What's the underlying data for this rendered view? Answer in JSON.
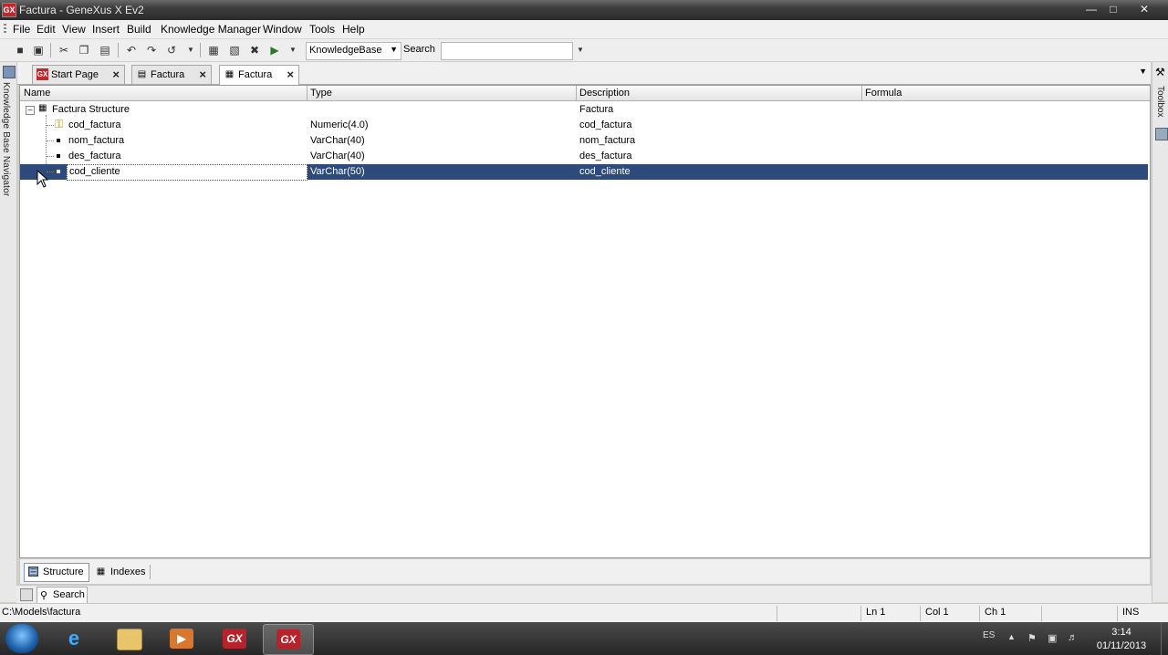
{
  "window": {
    "title": "Factura - GeneXus X Ev2",
    "app_icon": "GX"
  },
  "menu": [
    "File",
    "Edit",
    "View",
    "Insert",
    "Build",
    "Knowledge Manager",
    "Window",
    "Tools",
    "Help"
  ],
  "toolbar": {
    "kb_combo_value": "KnowledgeBase",
    "search_label": "Search",
    "search_value": ""
  },
  "side_panels": {
    "left_label": "Knowledge Base Navigator",
    "right_label": "Toolbox"
  },
  "doc_tabs": [
    {
      "label": "Start Page",
      "icon": "gx-start-icon"
    },
    {
      "label": "Factura",
      "icon": "transaction-icon"
    },
    {
      "label": "Factura",
      "icon": "table-icon",
      "active": true
    }
  ],
  "grid": {
    "columns": [
      "Name",
      "Type",
      "Description",
      "Formula"
    ],
    "root": {
      "name": "Factura Structure",
      "type": "",
      "description": "Factura",
      "formula": ""
    },
    "rows": [
      {
        "name": "cod_factura",
        "type": "Numeric(4.0)",
        "description": "cod_factura",
        "formula": "",
        "key": true
      },
      {
        "name": "nom_factura",
        "type": "VarChar(40)",
        "description": "nom_factura",
        "formula": ""
      },
      {
        "name": "des_factura",
        "type": "VarChar(40)",
        "description": "des_factura",
        "formula": ""
      },
      {
        "name": "cod_cliente",
        "type": "VarChar(50)",
        "description": "cod_cliente",
        "formula": "",
        "selected": true
      }
    ]
  },
  "bottom_tabs": [
    {
      "label": "Structure",
      "active": true
    },
    {
      "label": "Indexes"
    }
  ],
  "output_strip": {
    "search_label": "Search"
  },
  "status": {
    "path": "C:\\Models\\factura",
    "ln": "Ln 1",
    "col": "Col 1",
    "ch": "Ch 1",
    "mode": "INS"
  },
  "taskbar": {
    "apps": [
      {
        "name": "internet-explorer"
      },
      {
        "name": "file-explorer"
      },
      {
        "name": "media-player"
      },
      {
        "name": "genexus-ev2",
        "label": "GX"
      },
      {
        "name": "genexus-active",
        "label": "GX",
        "active": true
      }
    ],
    "language": "ES",
    "time": "3:14",
    "date": "01/11/2013"
  }
}
